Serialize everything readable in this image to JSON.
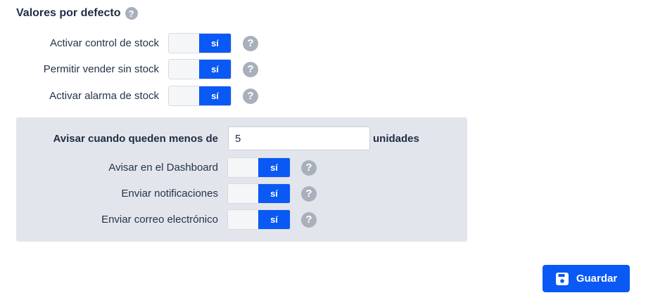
{
  "section": {
    "title": "Valores por defecto",
    "help_glyph": "?"
  },
  "settings": [
    {
      "label": "Activar control de stock",
      "toggle_on_label": "sí",
      "enabled": true
    },
    {
      "label": "Permitir vender sin stock",
      "toggle_on_label": "sí",
      "enabled": true
    },
    {
      "label": "Activar alarma de stock",
      "toggle_on_label": "sí",
      "enabled": true
    }
  ],
  "alarm_panel": {
    "threshold_label": "Avisar cuando queden menos de",
    "threshold_value": "5",
    "threshold_unit": "unidades",
    "options": [
      {
        "label": "Avisar en el Dashboard",
        "toggle_on_label": "sí",
        "enabled": true
      },
      {
        "label": "Enviar notificaciones",
        "toggle_on_label": "sí",
        "enabled": true
      },
      {
        "label": "Enviar correo electrónico",
        "toggle_on_label": "sí",
        "enabled": true
      }
    ]
  },
  "save_button": {
    "label": "Guardar",
    "icon": "save-icon"
  },
  "colors": {
    "accent": "#0a59f5",
    "panel_bg": "#e2e6ec",
    "help_icon": "#a9b0bc",
    "text": "#25334a"
  }
}
